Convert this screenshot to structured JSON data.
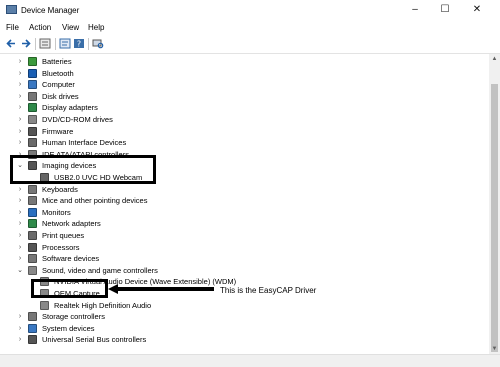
{
  "window": {
    "title": "Device Manager",
    "controls": {
      "minimize": "–",
      "maximize": "☐",
      "close": "✕"
    }
  },
  "menu": [
    "File",
    "Action",
    "View",
    "Help"
  ],
  "toolbar": [
    "back-icon",
    "forward-icon",
    "device-list-icon",
    "properties-icon",
    "help-icon",
    "scan-hardware-icon"
  ],
  "tree": [
    {
      "label": "Batteries",
      "expander": "›",
      "icon": "battery-icon",
      "color": "#3c9a3c"
    },
    {
      "label": "Bluetooth",
      "expander": "›",
      "icon": "bluetooth-icon",
      "color": "#1a5fb4"
    },
    {
      "label": "Computer",
      "expander": "›",
      "icon": "computer-icon",
      "color": "#3a78c2"
    },
    {
      "label": "Disk drives",
      "expander": "›",
      "icon": "disk-drive-icon",
      "color": "#777777"
    },
    {
      "label": "Display adapters",
      "expander": "›",
      "icon": "display-adapter-icon",
      "color": "#2f8a4a"
    },
    {
      "label": "DVD/CD-ROM drives",
      "expander": "›",
      "icon": "dvd-drive-icon",
      "color": "#888888"
    },
    {
      "label": "Firmware",
      "expander": "›",
      "icon": "firmware-icon",
      "color": "#555555"
    },
    {
      "label": "Human Interface Devices",
      "expander": "›",
      "icon": "hid-icon",
      "color": "#6a6a6a"
    },
    {
      "label": "IDE ATA/ATAPI controllers",
      "expander": "›",
      "icon": "ide-controller-icon",
      "color": "#7a7a7a"
    },
    {
      "label": "Imaging devices",
      "expander": "⌄",
      "icon": "imaging-device-icon",
      "color": "#555555"
    },
    {
      "label": "USB2.0 UVC HD Webcam",
      "expander": "",
      "icon": "webcam-icon",
      "color": "#666666",
      "child": true
    },
    {
      "label": "Keyboards",
      "expander": "›",
      "icon": "keyboard-icon",
      "color": "#777777"
    },
    {
      "label": "Mice and other pointing devices",
      "expander": "›",
      "icon": "mouse-icon",
      "color": "#777777"
    },
    {
      "label": "Monitors",
      "expander": "›",
      "icon": "monitor-icon",
      "color": "#2a6fc0"
    },
    {
      "label": "Network adapters",
      "expander": "›",
      "icon": "network-adapter-icon",
      "color": "#2f8a4a"
    },
    {
      "label": "Print queues",
      "expander": "›",
      "icon": "printer-icon",
      "color": "#6a6a6a"
    },
    {
      "label": "Processors",
      "expander": "›",
      "icon": "processor-icon",
      "color": "#555555"
    },
    {
      "label": "Software devices",
      "expander": "›",
      "icon": "software-device-icon",
      "color": "#777777"
    },
    {
      "label": "Sound, video and game controllers",
      "expander": "⌄",
      "icon": "sound-icon",
      "color": "#888888"
    },
    {
      "label": "NVIDIA Virtual Audio Device (Wave Extensible) (WDM)",
      "expander": "",
      "icon": "audio-device-icon",
      "color": "#888888",
      "child": true
    },
    {
      "label": "OEM Capture",
      "expander": "",
      "icon": "capture-device-icon",
      "color": "#888888",
      "child": true
    },
    {
      "label": "Realtek High Definition Audio",
      "expander": "",
      "icon": "audio-device-icon",
      "color": "#888888",
      "child": true
    },
    {
      "label": "Storage controllers",
      "expander": "›",
      "icon": "storage-controller-icon",
      "color": "#777777"
    },
    {
      "label": "System devices",
      "expander": "›",
      "icon": "system-device-icon",
      "color": "#3a78c2"
    },
    {
      "label": "Universal Serial Bus controllers",
      "expander": "›",
      "icon": "usb-icon",
      "color": "#555555"
    }
  ],
  "annotation": {
    "text": "This is the EasyCAP Driver",
    "arrow": "◀━━━━━━━━━━━━━━━━━"
  }
}
